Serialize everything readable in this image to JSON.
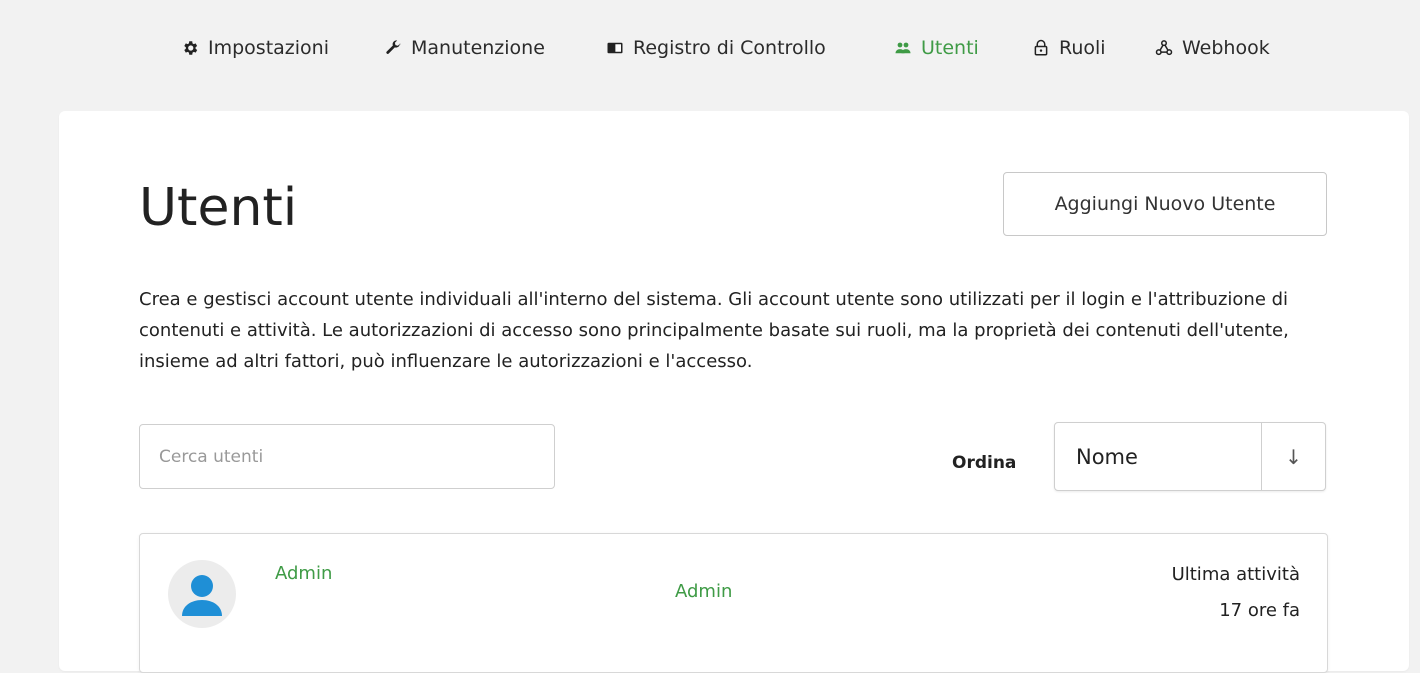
{
  "nav": {
    "items": [
      {
        "label": "Impostazioni",
        "icon": "gear-icon"
      },
      {
        "label": "Manutenzione",
        "icon": "wrench-icon"
      },
      {
        "label": "Registro di Controllo",
        "icon": "book-icon"
      },
      {
        "label": "Utenti",
        "icon": "users-icon",
        "active": true
      },
      {
        "label": "Ruoli",
        "icon": "lock-icon"
      },
      {
        "label": "Webhook",
        "icon": "webhook-icon"
      }
    ]
  },
  "colors": {
    "accent": "#3f9b46",
    "avatar": "#1f8fd6",
    "background": "#f2f2f2"
  },
  "page": {
    "title": "Utenti",
    "add_button_label": "Aggiungi Nuovo Utente",
    "description": "Crea e gestisci account utente individuali all'interno del sistema. Gli account utente sono utilizzati per il login e l'attribuzione di contenuti e attività. Le autorizzazioni di accesso sono principalmente basate sui ruoli, ma la proprietà dei contenuti dell'utente, insieme ad altri fattori, può influenzare le autorizzazioni e l'accesso."
  },
  "search": {
    "placeholder": "Cerca utenti",
    "value": ""
  },
  "sort": {
    "label": "Ordina",
    "selected": "Nome",
    "direction_icon": "↓"
  },
  "users": [
    {
      "name": "Admin",
      "role": "Admin",
      "last_activity_label": "Ultima attività",
      "last_activity_value": "17 ore fa"
    }
  ]
}
